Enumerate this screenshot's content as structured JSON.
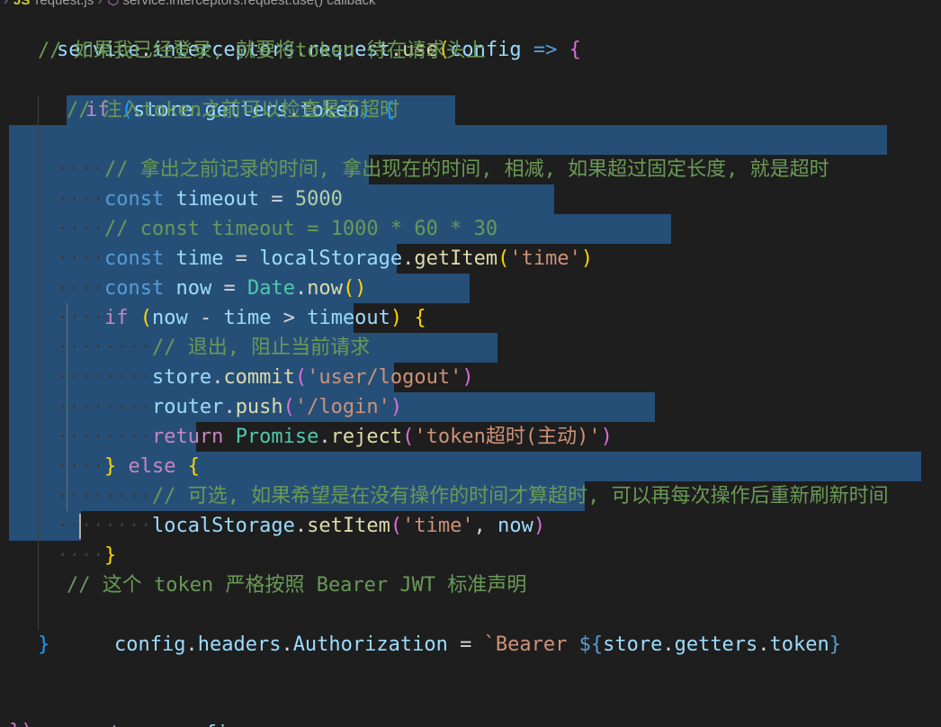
{
  "breadcrumb": {
    "file_icon": "JS",
    "file": "request.js",
    "symbol_icon": "cube-icon",
    "symbol": "service.interceptors.request.use() callback"
  },
  "code": {
    "l1": [
      "service",
      ".",
      "interceptors",
      ".",
      "request",
      ".",
      "use",
      "(",
      "config",
      " => ",
      "{"
    ],
    "l2": "// 如果我已经登录, 就要将token 待在请求头上",
    "l3": [
      "if",
      " (",
      "store",
      ".",
      "getters",
      ".",
      "token",
      ") ",
      "{"
    ],
    "l4": "// 注入token之前可以检查是否超时",
    "l5": "// 拿出之前记录的时间, 拿出现在的时间, 相减, 如果超过固定长度, 就是超时",
    "l6": [
      "const",
      " ",
      "timeout",
      " = ",
      "5000"
    ],
    "l7": "// const timeout = 1000 * 60 * 30",
    "l8": [
      "const",
      " ",
      "time",
      " = ",
      "localStorage",
      ".",
      "getItem",
      "(",
      "'time'",
      ")"
    ],
    "l9": [
      "const",
      " ",
      "now",
      " = ",
      "Date",
      ".",
      "now",
      "()"
    ],
    "l10": [
      "if",
      " ",
      "(",
      "now",
      " - ",
      "time",
      " > ",
      "timeout",
      ") ",
      "{"
    ],
    "l11": "// 退出, 阻止当前请求",
    "l12": [
      "store",
      ".",
      "commit",
      "(",
      "'user/logout'",
      ")"
    ],
    "l13": [
      "router",
      ".",
      "push",
      "(",
      "'/login'",
      ")"
    ],
    "l14": [
      "return",
      " ",
      "Promise",
      ".",
      "reject",
      "(",
      "'token超时(主动)'",
      ")"
    ],
    "l15": [
      "}",
      " ",
      "else",
      " ",
      "{"
    ],
    "l16": "// 可选, 如果希望是在没有操作的时间才算超时, 可以再每次操作后重新刷新时间",
    "l17": [
      "localStorage",
      ".",
      "setItem",
      "(",
      "'time'",
      ", ",
      "now",
      ")"
    ],
    "l18": "}",
    "l20": "// 这个 token 严格按照 Bearer JWT 标准声明",
    "l21": [
      "config",
      ".",
      "headers",
      ".",
      "Authorization",
      " = ",
      "`Bearer ",
      "${",
      "store",
      ".",
      "getters",
      ".",
      "token",
      "}"
    ],
    "l22": "}",
    "l24": [
      "return",
      " ",
      "config"
    ],
    "l25": "})"
  }
}
